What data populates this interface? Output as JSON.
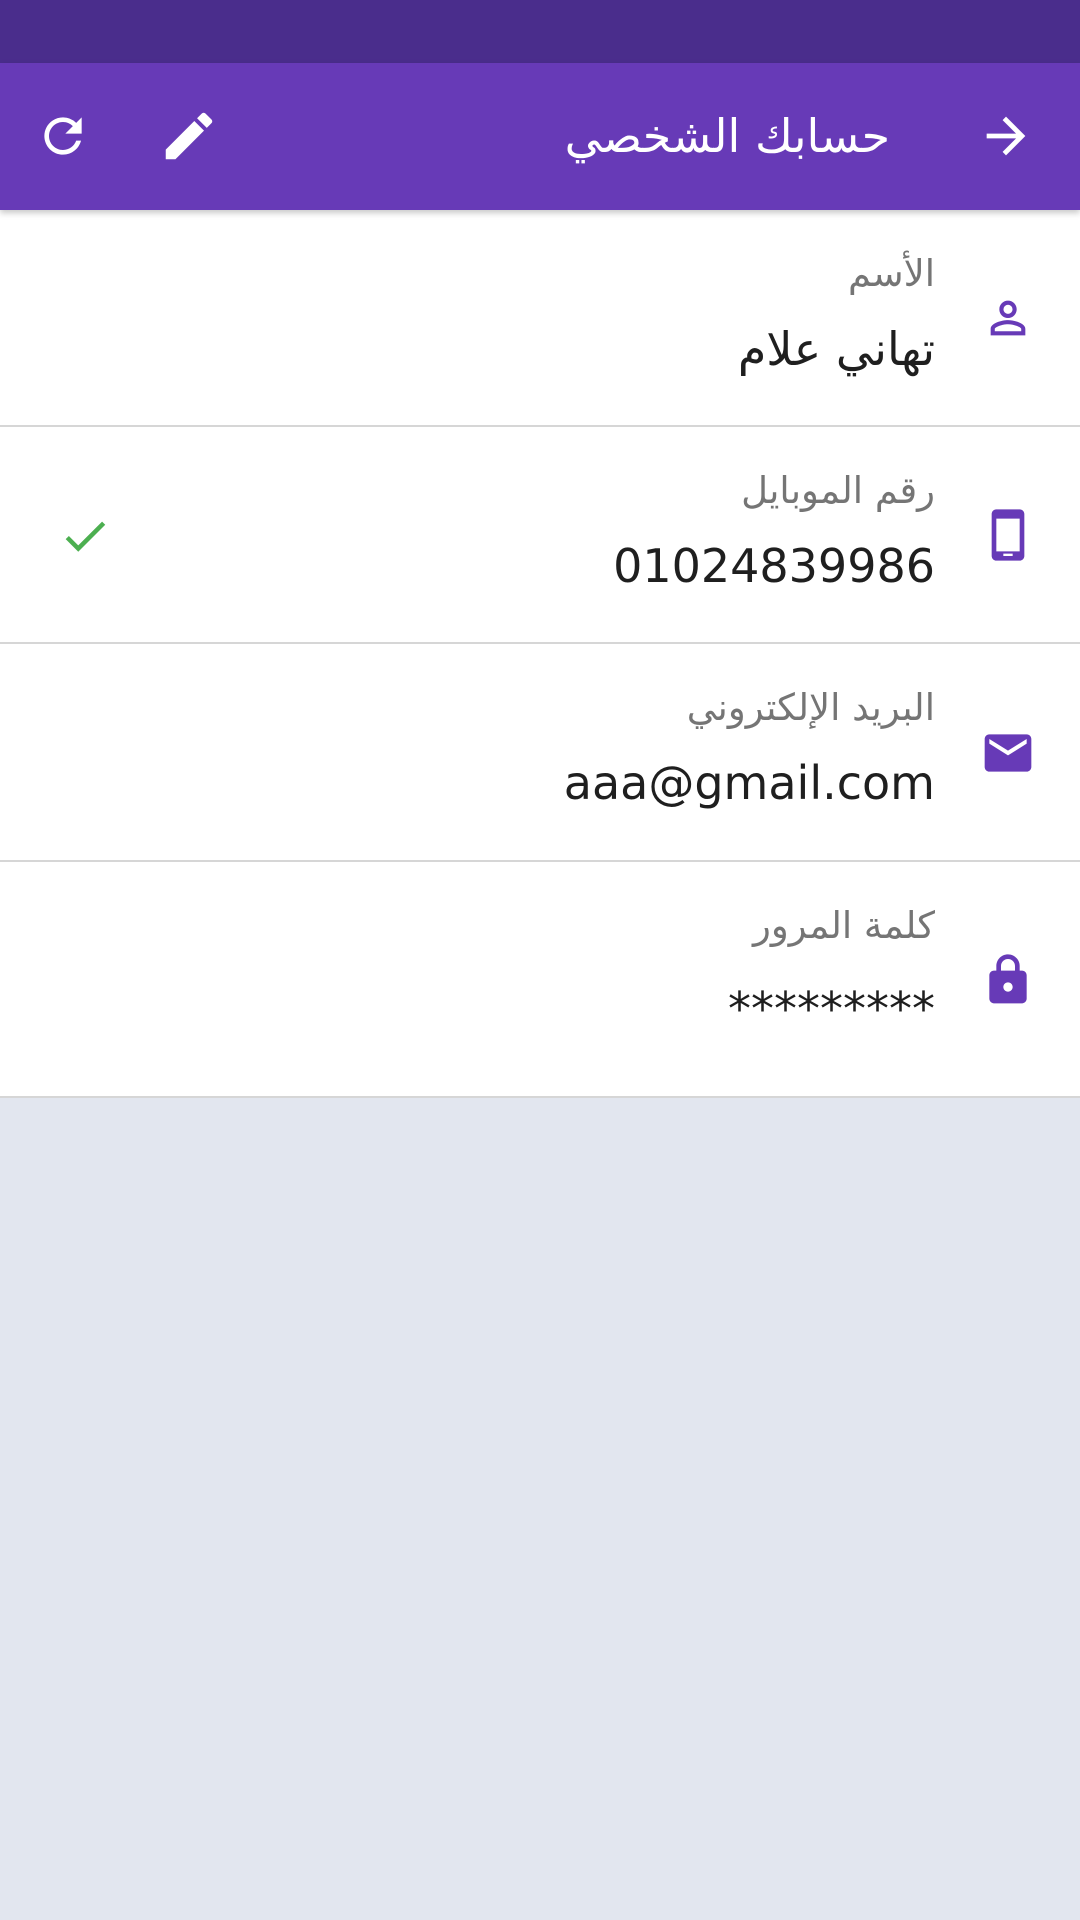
{
  "header": {
    "title": "حسابك الشخصي",
    "icons": {
      "back": "arrow-forward-icon",
      "edit": "pencil-icon",
      "refresh": "refresh-icon"
    }
  },
  "profile": {
    "fields": [
      {
        "label": "الأسم",
        "value": "تهاني علام",
        "icon": "person-icon",
        "verified": false
      },
      {
        "label": "رقم الموبايل",
        "value": "01024839986",
        "icon": "phone-icon",
        "verified": true
      },
      {
        "label": "البريد الإلكتروني",
        "value": "aaa@gmail.com",
        "icon": "email-icon",
        "verified": false
      },
      {
        "label": "كلمة المرور",
        "value": "*********",
        "icon": "lock-icon",
        "verified": false
      }
    ]
  },
  "colors": {
    "status_bar": "#4a2d8c",
    "app_bar": "#673ab7",
    "accent": "#673ab7",
    "verified": "#4caf50",
    "background": "#e2e6ef"
  }
}
